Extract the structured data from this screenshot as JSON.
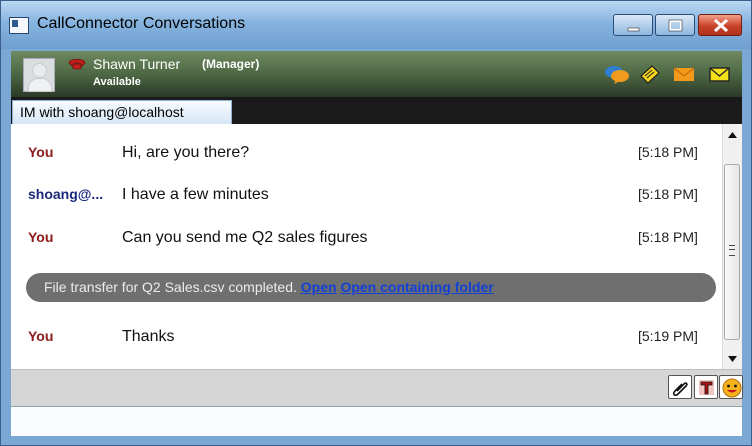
{
  "window": {
    "title": "CallConnector Conversations"
  },
  "user": {
    "name": "Shawn Turner",
    "role": "(Manager)",
    "status": "Available"
  },
  "tab": {
    "label": "IM with shoang@localhost"
  },
  "messages": [
    {
      "sender": "You",
      "sender_color": "#8b1a1a",
      "text": "Hi, are you there?",
      "time": "[5:18 PM]"
    },
    {
      "sender": "shoang@...",
      "sender_color": "#1a2a7a",
      "text": "I have a few minutes",
      "time": "[5:18 PM]"
    },
    {
      "sender": "You",
      "sender_color": "#8b1a1a",
      "text": "Can you send me Q2 sales figures",
      "time": "[5:18 PM]"
    },
    {
      "sender": "You",
      "sender_color": "#8b1a1a",
      "text": "Thanks",
      "time": "[5:19 PM]"
    }
  ],
  "file_transfer": {
    "text": "File transfer for Q2 Sales.csv completed.",
    "open_link": "Open",
    "open_folder_link": "Open containing folder"
  },
  "toolbar_icons": [
    "attach-icon",
    "font-icon",
    "emoticon-icon"
  ],
  "userbar_icons": [
    "chat-icon",
    "notes-icon",
    "email-icon",
    "voicemail-icon"
  ],
  "input": {
    "value": "",
    "placeholder": ""
  }
}
